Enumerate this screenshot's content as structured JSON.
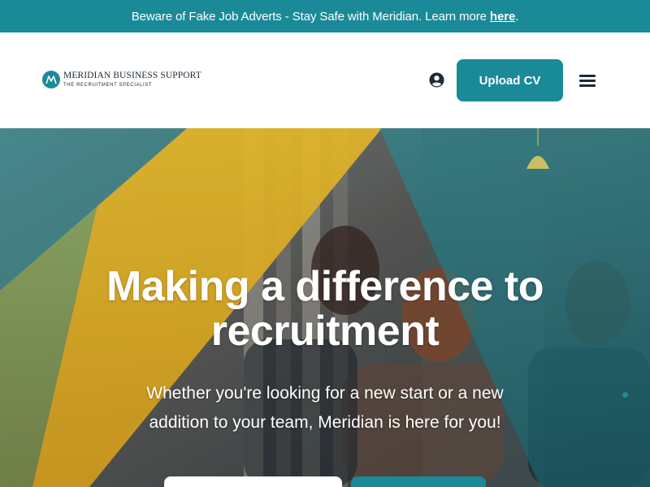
{
  "alert": {
    "text": "Beware of Fake Job Adverts - Stay Safe with Meridian. Learn more ",
    "link_label": "here",
    "suffix": "."
  },
  "header": {
    "logo": {
      "name": "MERIDIAN BUSINESS SUPPORT",
      "tagline": "THE RECRUITMENT SPECIALIST"
    },
    "icons": {
      "account": "user-circle-icon",
      "menu": "hamburger-menu-icon"
    },
    "upload_label": "Upload CV"
  },
  "hero": {
    "title_line1": "Making a difference to",
    "title_line2": "recruitment",
    "subtitle": "Whether you're looking for a new start or a new addition to your team, Meridian is here for you!",
    "button1_label": "",
    "button2_label": ""
  },
  "colors": {
    "brand_teal": "#1a8a99",
    "navy": "#1d2b3a",
    "accent_yellow": "#f2c12e",
    "white": "#ffffff"
  }
}
